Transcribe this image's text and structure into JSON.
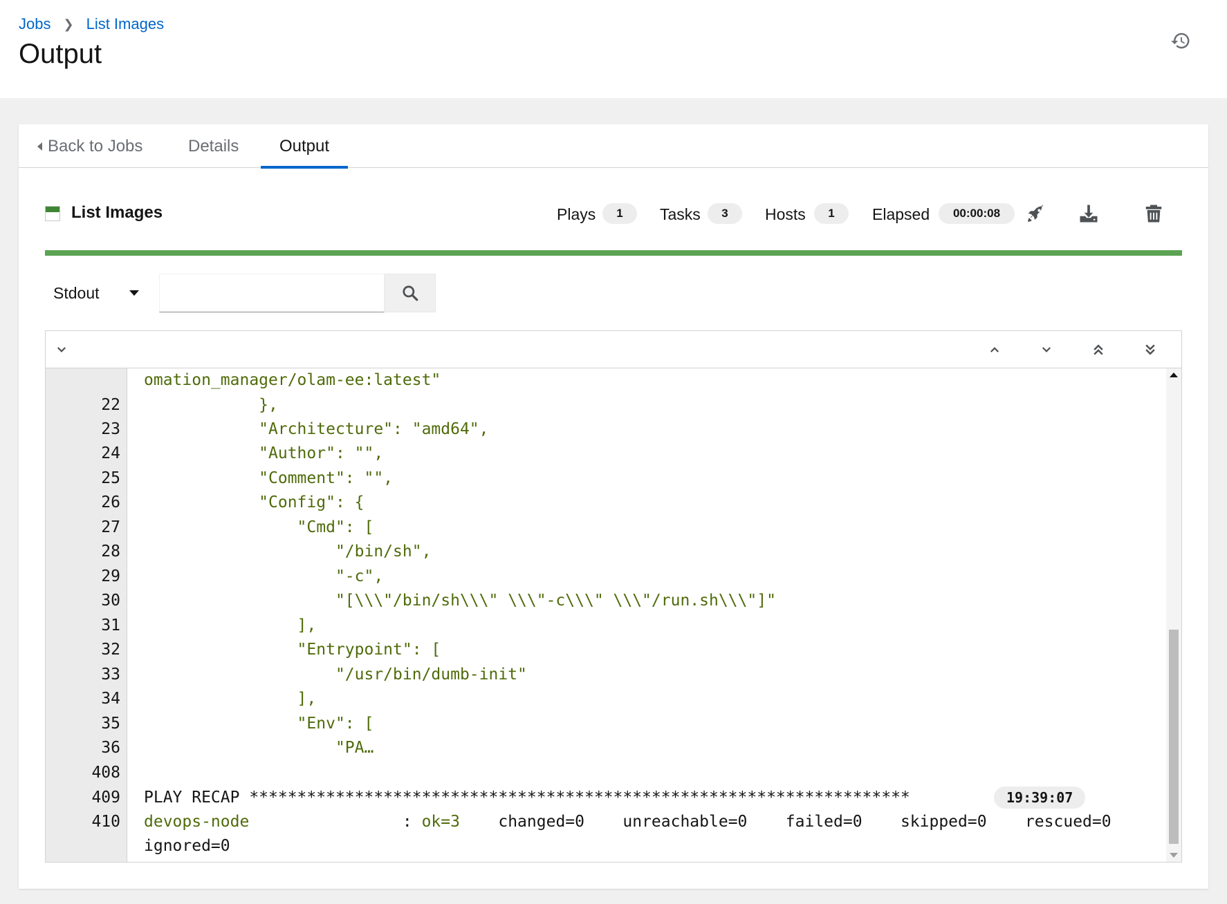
{
  "breadcrumb": {
    "items": [
      "Jobs",
      "List Images"
    ]
  },
  "page": {
    "title": "Output"
  },
  "tabs": [
    {
      "label": "Back to Jobs"
    },
    {
      "label": "Details"
    },
    {
      "label": "Output",
      "active": true
    }
  ],
  "job": {
    "name": "List Images",
    "status": "successful",
    "stats": {
      "plays_label": "Plays",
      "plays": "1",
      "tasks_label": "Tasks",
      "tasks": "3",
      "hosts_label": "Hosts",
      "hosts": "1",
      "elapsed_label": "Elapsed",
      "elapsed": "00:00:08"
    },
    "progress_percent": 100,
    "status_color": "#5ba352"
  },
  "filter": {
    "type_selected": "Stdout",
    "search_value": ""
  },
  "output": {
    "lines": [
      {
        "num": "",
        "text": "omation_manager/olam-ee:latest\""
      },
      {
        "num": "22",
        "text": "            },"
      },
      {
        "num": "23",
        "text": "            \"Architecture\": \"amd64\","
      },
      {
        "num": "24",
        "text": "            \"Author\": \"\","
      },
      {
        "num": "25",
        "text": "            \"Comment\": \"\","
      },
      {
        "num": "26",
        "text": "            \"Config\": {"
      },
      {
        "num": "27",
        "text": "                \"Cmd\": ["
      },
      {
        "num": "28",
        "text": "                    \"/bin/sh\","
      },
      {
        "num": "29",
        "text": "                    \"-c\","
      },
      {
        "num": "30",
        "text": "                    \"[\\\\\\\"/bin/sh\\\\\\\" \\\\\\\"-c\\\\\\\" \\\\\\\"/run.sh\\\\\\\"]\""
      },
      {
        "num": "31",
        "text": "                ],"
      },
      {
        "num": "32",
        "text": "                \"Entrypoint\": ["
      },
      {
        "num": "33",
        "text": "                    \"/usr/bin/dumb-init\""
      },
      {
        "num": "34",
        "text": "                ],"
      },
      {
        "num": "35",
        "text": "                \"Env\": ["
      },
      {
        "num": "36",
        "text": "                    \"PA…"
      },
      {
        "num": "408",
        "text": ""
      }
    ],
    "recap_line": {
      "num": "409",
      "text": "PLAY RECAP *********************************************************************",
      "time": "19:39:07"
    },
    "host_line": {
      "num": "410",
      "host": "devops-node",
      "sep": "                : ",
      "ok": "ok=3",
      "rest": "    changed=0    unreachable=0    failed=0    skipped=0    rescued=0",
      "cont": "ignored=0"
    }
  }
}
